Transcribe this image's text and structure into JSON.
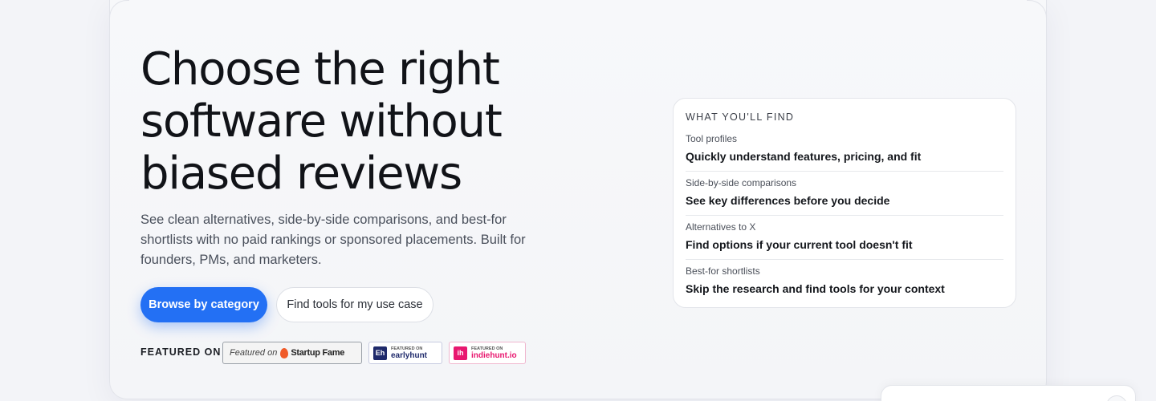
{
  "hero": {
    "headline_line1": "Choose the right",
    "headline_line2": "software without",
    "headline_line3": "biased reviews",
    "subtext": "See clean alternatives, side-by-side comparisons, and best-for shortlists with no paid rankings or sponsored placements. Built for founders, PMs, and marketers.",
    "primary_button": "Browse by category",
    "secondary_button": "Find tools for my use case",
    "featured_label": "FEATURED ON",
    "badges": [
      {
        "icon": "flame-icon",
        "pre": "Featured on",
        "name": "Startup Fame"
      },
      {
        "icon": "earlyhunt-logo-icon",
        "logo_text": "Eh",
        "pre": "FEATURED ON",
        "name": "earlyhunt"
      },
      {
        "icon": "indiehunt-logo-icon",
        "logo_text": "ih",
        "pre": "FEATURED ON",
        "name": "indiehunt.io"
      }
    ],
    "colors": {
      "primary": "#2370f4",
      "indiehunt": "#e8176f",
      "earlyhunt": "#1f2a6b"
    }
  },
  "find_card": {
    "title": "WHAT YOU'LL FIND",
    "items": [
      {
        "label": "Tool profiles",
        "value": "Quickly understand features, pricing, and fit"
      },
      {
        "label": "Side-by-side comparisons",
        "value": "See key differences before you decide"
      },
      {
        "label": "Alternatives to X",
        "value": "Find options if your current tool doesn't fit"
      },
      {
        "label": "Best-for shortlists",
        "value": "Skip the research and find tools for your context"
      }
    ]
  }
}
